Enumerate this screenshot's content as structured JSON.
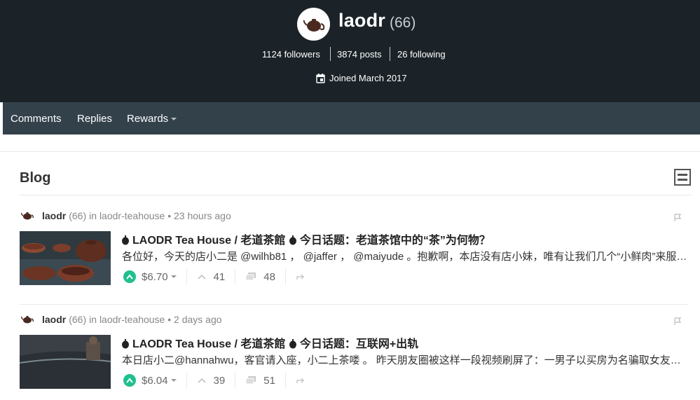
{
  "profile": {
    "username": "laodr",
    "reputation": "(66)",
    "followers": "1124 followers",
    "posts": "3874 posts",
    "following": "26 following",
    "joined": "Joined March 2017"
  },
  "nav": {
    "comments": "Comments",
    "replies": "Replies",
    "rewards": "Rewards"
  },
  "blog": {
    "title": "Blog"
  },
  "posts": [
    {
      "author": "laodr",
      "reputation": "(66)",
      "in_label": "in",
      "category": "laodr-teahouse",
      "time": "• 23 hours ago",
      "title": "LAODR Tea House / 老道茶館 🍵今日话题：老道茶馆中的“茶”为何物？",
      "title_a": "LAODR Tea House / 老道茶館",
      "title_b": "今日话题：老道茶馆中的“茶”为何物？",
      "body": "各位好，今天的店小二是 @wilhb81 ， @jaffer ， @maiyude 。抱歉啊，本店没有店小妹，唯有让我们几个“小鲜肉”来服务大家了",
      "payout": "$6.70",
      "votes": "41",
      "comments": "48"
    },
    {
      "author": "laodr",
      "reputation": "(66)",
      "in_label": "in",
      "category": "laodr-teahouse",
      "time": "• 2 days ago",
      "title_a": "LAODR Tea House / 老道茶館",
      "title_b": "今日话题：互联网+出轨",
      "body": "本日店小二@hannahwu，客官请入座，小二上茶喽 。 昨天朋友圈被这样一段视频刷屏了：一男子以买房为名骗取女友信任",
      "payout": "$6.04",
      "votes": "39",
      "comments": "51"
    }
  ],
  "colors": {
    "header_bg": "#1b2328",
    "nav_bg": "#33414b",
    "upvote": "#1fbf8f"
  },
  "icons": [
    "teapot-avatar-icon",
    "calendar-icon",
    "caret-down-icon",
    "layout-toggle-icon",
    "flag-icon",
    "teapot-title-icon",
    "upvote-icon",
    "like-icon",
    "comment-icon",
    "reblog-icon"
  ]
}
